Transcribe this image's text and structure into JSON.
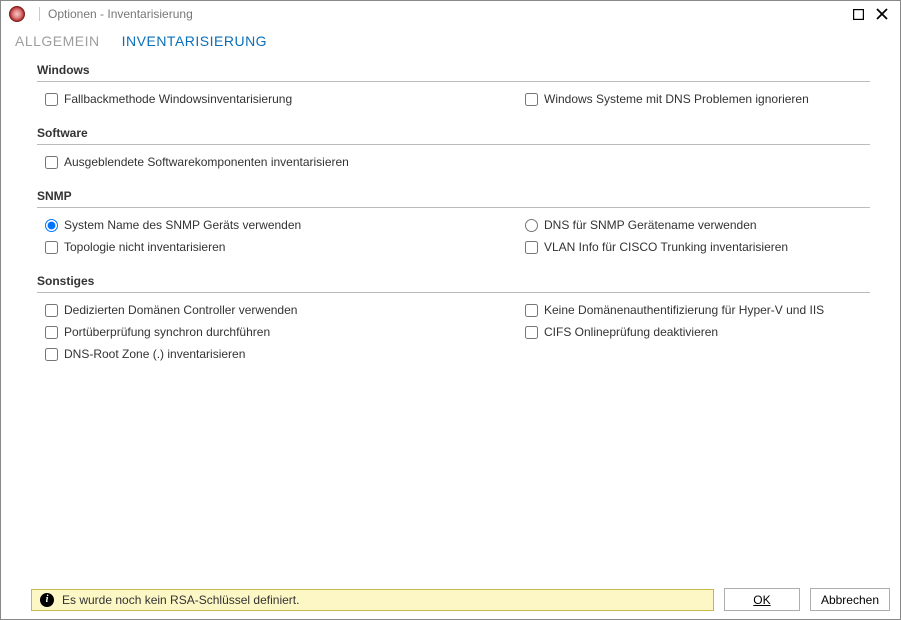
{
  "window": {
    "title": "Optionen - Inventarisierung"
  },
  "tabs": {
    "general": "ALLGEMEIN",
    "inventory": "INVENTARISIERUNG"
  },
  "sections": {
    "windows": {
      "title": "Windows",
      "fallback": "Fallbackmethode Windowsinventarisierung",
      "ignore_dns": "Windows Systeme mit DNS Problemen ignorieren"
    },
    "software": {
      "title": "Software",
      "hidden_components": "Ausgeblendete Softwarekomponenten inventarisieren"
    },
    "snmp": {
      "title": "SNMP",
      "use_system_name": "System Name des SNMP Geräts verwenden",
      "use_dns_name": "DNS für SNMP Gerätename verwenden",
      "no_topology": "Topologie nicht inventarisieren",
      "vlan_cisco": "VLAN Info für CISCO Trunking inventarisieren"
    },
    "misc": {
      "title": "Sonstiges",
      "dedicated_dc": "Dedizierten Domänen Controller verwenden",
      "no_domain_auth": "Keine Domänenauthentifizierung für Hyper-V und IIS",
      "port_sync": "Portüberprüfung synchron durchführen",
      "cifs_off": "CIFS Onlineprüfung deaktivieren",
      "dns_root": "DNS-Root Zone (.) inventarisieren"
    }
  },
  "footer": {
    "info": "Es wurde noch kein RSA-Schlüssel definiert.",
    "ok": "OK",
    "cancel": "Abbrechen"
  }
}
